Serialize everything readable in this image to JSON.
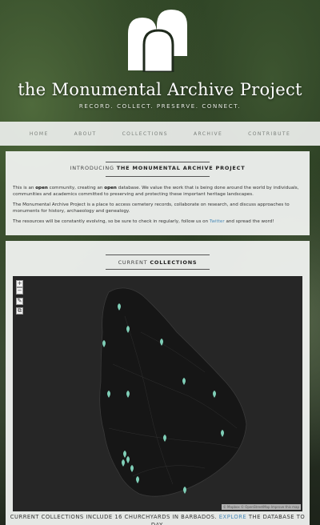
{
  "header": {
    "title": "the Monumental Archive Project",
    "tagline": "RECORD. COLLECT. PRESERVE. CONNECT."
  },
  "nav": {
    "items": [
      {
        "label": "HOME"
      },
      {
        "label": "ABOUT"
      },
      {
        "label": "COLLECTIONS"
      },
      {
        "label": "ARCHIVE"
      },
      {
        "label": "CONTRIBUTE"
      }
    ]
  },
  "intro": {
    "heading_prefix": "INTRODUCING",
    "heading_bold": "THE MONUMENTAL ARCHIVE PROJECT",
    "p1_a": "This is an",
    "p1_open1": "open",
    "p1_b": "community, creating an",
    "p1_open2": "open",
    "p1_c": "database. We value the work that is being done around the world by individuals, communities and academics committed to preserving and protecting these important heritage landscapes.",
    "p2": "The Monumental Archive Project is a place to access cemetery records, collaborate on research, and discuss approaches to monuments for history, archaeology and genealogy.",
    "p3_a": "The resources will be constantly evolving, so be sure to check in regularly, follow us on",
    "p3_link": "Twitter",
    "p3_b": "and spread the word!"
  },
  "collections": {
    "heading_prefix": "CURRENT",
    "heading_bold": "COLLECTIONS",
    "footer_a": "CURRENT COLLECTIONS INCLUDE 16 CHURCHYARDS IN BARBADOS.",
    "footer_link": "EXPLORE",
    "footer_b": "THE DATABASE TO DAY."
  },
  "map": {
    "zoom_in": "+",
    "zoom_out": "−",
    "tool1": "✎",
    "tool2": "⧉",
    "attribution": "© Mapbox © OpenStreetMap Improve this map"
  },
  "colors": {
    "accent_link": "#4a8ab8",
    "marker": "#7fcfb8",
    "map_bg": "#262626",
    "island": "#161616"
  }
}
